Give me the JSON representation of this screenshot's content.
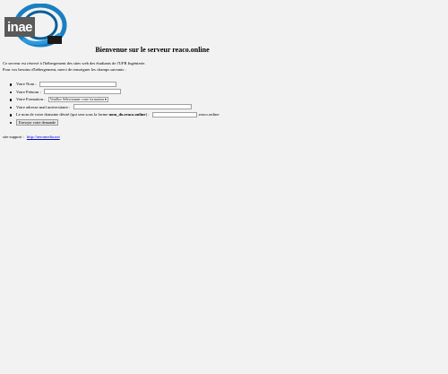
{
  "logo": {
    "text": "inae",
    "alt": "logo",
    "colors": {
      "ring": "#1a7fc1",
      "ring_dark": "#0b5e96",
      "swoosh": "#2a9be0"
    }
  },
  "page": {
    "title": "Bienvenue sur le serveur reaco.online",
    "intro_line1": "Ce serveur est réservé à l'hébergement des sites web des étudiants de l'UFR Ingénierie.",
    "intro_line2": "Pour vos besoins d'hébergement, merci de renseigner les champs suivants :"
  },
  "form": {
    "nom_label": "Votre Nom :",
    "prenom_label": "Votre Prénom :",
    "formation_label": "Votre Formation :",
    "formation_selected": "Veuillez Sélectionner votre formation",
    "email_label": "Votre adresse mail universitaire :",
    "domain_label_before": "Le nom de votre domaine désiré (qui sera sous la forme ",
    "domain_label_bold": "nom_du.reaco.online",
    "domain_label_after": ") :",
    "domain_suffix": ".reaco.online",
    "submit_label": "Envoyer votre demande"
  },
  "support": {
    "label": "site support :",
    "link": "http://aeromedia.net"
  }
}
